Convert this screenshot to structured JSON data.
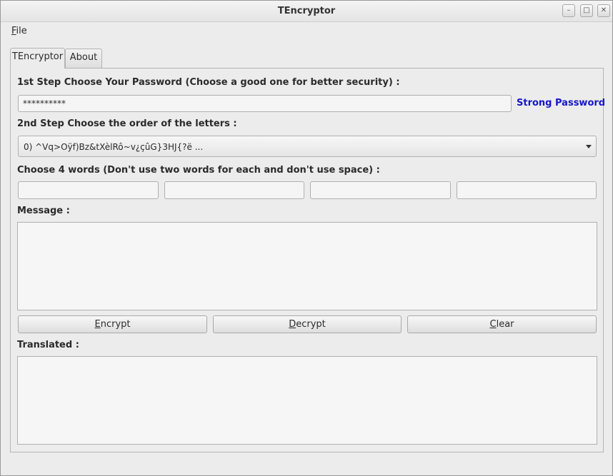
{
  "window": {
    "title": "TEncryptor"
  },
  "menu": {
    "file_label": "File",
    "file_mnemonic": "F",
    "file_rest": "ile"
  },
  "tabs": [
    {
      "label": "TEncryptor"
    },
    {
      "label": "About"
    }
  ],
  "step1": {
    "label": "1st Step Choose Your Password (Choose a good one for better security) :",
    "password_value": "**********",
    "strength": "Strong Password",
    "strength_color": "#1515cc"
  },
  "step2": {
    "label": "2nd Step Choose the order of the letters :",
    "selected_option": "0)    ^Vq>Oÿf)Bz&tXèlRô~v¿çûG}3HJ{?ë ..."
  },
  "step3": {
    "label": "Choose 4 words (Don't use two words for each and don't use space) :",
    "words": [
      "",
      "",
      "",
      ""
    ]
  },
  "message": {
    "label": "Message :",
    "value": ""
  },
  "buttons": {
    "encrypt": {
      "mnemonic": "E",
      "rest": "ncrypt"
    },
    "decrypt": {
      "mnemonic": "D",
      "rest": "ecrypt"
    },
    "clear": {
      "mnemonic": "C",
      "rest": "lear"
    }
  },
  "translated": {
    "label": "Translated :",
    "value": ""
  }
}
